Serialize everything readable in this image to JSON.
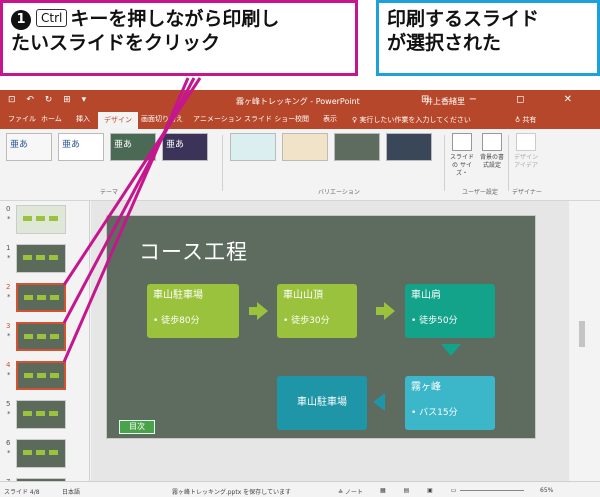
{
  "callouts": {
    "left": {
      "number": "1",
      "key": "Ctrl",
      "line1_rest": "キーを押しながら印刷し",
      "line2": "たいスライドをクリック"
    },
    "right": {
      "line1": "印刷するスライド",
      "line2": "が選択された"
    },
    "colors": {
      "left_border": "#c6168d",
      "right_border": "#1ea0d8"
    }
  },
  "window": {
    "qat": "⊡ ↶ ↻ ⊞ ▾",
    "title": "霧ヶ峰トレッキング - PowerPoint",
    "user": "井上香緒里",
    "buttons": "⊞ − ◻ ✕",
    "accent": "#b7472a"
  },
  "tabs": [
    "ファイル",
    "ホーム",
    "挿入",
    "デザイン",
    "画面切り替え",
    "アニメーション",
    "スライド ショー",
    "校閲",
    "表示"
  ],
  "active_tab": "デザイン",
  "tell_me": "♀ 実行したい作業を入力してください",
  "share": "♁ 共有",
  "ribbon": {
    "themes": [
      "亜あ",
      "亜あ",
      "亜あ",
      "亜あ"
    ],
    "group_theme": "テーマ",
    "group_variation": "バリエーション",
    "btn_slide_size": "スライドの\nサイズ・",
    "btn_bg_format": "背景の書\n式設定",
    "btn_designer": "デザイン\nアイデア",
    "group_user": "ユーザー設定",
    "group_designer": "デザイナー"
  },
  "thumbnails": [
    {
      "num": "0",
      "selected": false
    },
    {
      "num": "1",
      "selected": false
    },
    {
      "num": "2",
      "selected": true
    },
    {
      "num": "3",
      "selected": true
    },
    {
      "num": "4",
      "selected": true
    },
    {
      "num": "5",
      "selected": false
    },
    {
      "num": "6",
      "selected": false
    },
    {
      "num": "7",
      "selected": false
    }
  ],
  "slide": {
    "title": "コース工程",
    "boxes": [
      {
        "title": "車山駐車場",
        "sub": "• 徒歩80分"
      },
      {
        "title": "車山山頂",
        "sub": "• 徒歩30分"
      },
      {
        "title": "車山肩",
        "sub": "• 徒歩50分"
      },
      {
        "title": "霧ヶ峰",
        "sub": "• バス15分"
      },
      {
        "title": "車山駐車場",
        "sub": ""
      }
    ],
    "toc_button": "目次"
  },
  "status": {
    "slide_info": "スライド 4/8",
    "lang": "日本語",
    "saving": "霧ヶ峰トレッキング.pptx を保存しています",
    "notes": "≙ ノート",
    "zoom": "65%"
  }
}
